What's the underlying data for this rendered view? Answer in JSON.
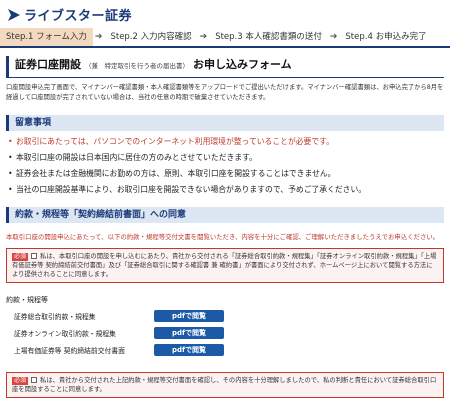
{
  "header": {
    "logo_text": "ライブスター証券"
  },
  "steps": [
    {
      "label": "Step.1 フォーム入力"
    },
    {
      "label": "Step.2 入力内容確認"
    },
    {
      "label": "Step.3 本人確認書類の送付"
    },
    {
      "label": "Step.4 お申込み完了"
    }
  ],
  "step_arrow": "➔",
  "page": {
    "title": "証券口座開設",
    "title_sub": "（兼　特定取引を行う者の届出書）",
    "title_main": "お申し込みフォーム"
  },
  "intro": "口座開設申込完了画面で、マイナンバー確認書類・本人確認書類等をアップロードでご提出いただけます。マイナンバー確認書類は、お申込完了から8月を経過して口座開設が完了されていない場合は、当社の任意の時期で破棄させていただきます。",
  "notice": {
    "title": "留意事項",
    "items": [
      "お取引にあたっては、パソコンでのインターネット利用環境が整っていることが必要です。",
      "本取引口座の開設は日本国内に居住の方のみとさせていただきます。",
      "証券会社または金融機関にお勤めの方は、原則、本取引口座を開設することはできません。",
      "当社の口座開設基準により、お取引口座を開設できない場合がありますので、予めご了承ください。"
    ]
  },
  "terms": {
    "title": "約款・規程等「契約締結前書面」への同意",
    "red_note": "本取引口座の開設申込にあたって、以下の約款・規程等交付文書を閲覧いただき、内容を十分にご確認、ご理解いただきましたうえでお申込ください。",
    "required_label": "必須",
    "agree1": "私は、本取引口座の開設を申し込むにあたり、貴社から交付される「証券総合取引約款・規程集」「証券オンライン取引約款・規程集」「上場有価証券等 契約締結前交付書面」及び「証券総合取引に関する確認書 兼 確約書」が書面により交付されず、ホームページ上において閲覧する方法により提供されることに同意します。",
    "docs_heading": "約款・規程等",
    "docs": [
      {
        "name": "証券総合取引約款・規程集",
        "button": "pdfで閲覧"
      },
      {
        "name": "証券オンライン取引約款・規程集",
        "button": "pdfで閲覧"
      },
      {
        "name": "上場有価証券等 契約締結前交付書面",
        "button": "pdfで閲覧"
      }
    ],
    "agree2": "私は、貴社から交付された上記約款・規程等交付書面を確認し、その内容を十分理解しましたので、私の判断と責任において証券総合取引口座を開設することに同意します。"
  },
  "colors": {
    "brand": "#1a3a78",
    "active_step": "#f3d9bf",
    "section_bg": "#dde6f3",
    "alert": "#c0392b",
    "pdf_button": "#1c5aa8"
  }
}
